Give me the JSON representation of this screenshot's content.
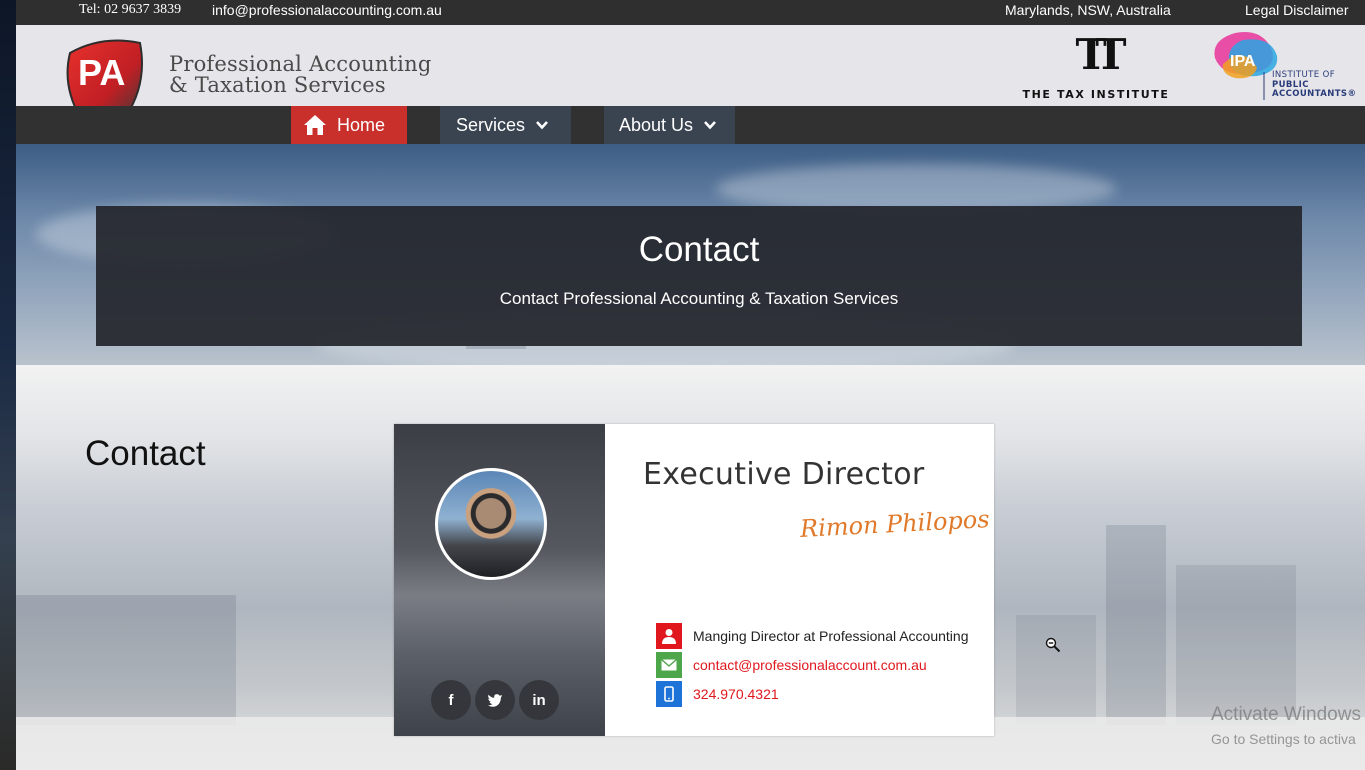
{
  "topbar": {
    "phone": "Tel: 02 9637 3839",
    "email": "info@professionalaccounting.com.au",
    "location": "Marylands, NSW, Australia",
    "legal": "Legal Disclaimer"
  },
  "header": {
    "logo_letters": "PA",
    "brand_line1": "Professional Accounting",
    "brand_line2": "& Taxation Services",
    "tax_institute": "THE TAX INSTITUTE",
    "ipa_mark": "IPA",
    "ipa_line1": "INSTITUTE OF",
    "ipa_line2": "PUBLIC",
    "ipa_line3": "ACCOUNTANTS"
  },
  "nav": {
    "home": "Home",
    "services": "Services",
    "about": "About Us"
  },
  "hero": {
    "title": "Contact",
    "subtitle": "Contact Professional Accounting & Taxation Services"
  },
  "content": {
    "title": "Contact"
  },
  "card": {
    "title": "Executive Director",
    "signature": "Rimon Philopos",
    "role": "Manging Director at Professional Accounting",
    "email": "contact@professionalaccount.com.au",
    "phone": "324.970.4321",
    "social": {
      "facebook": "f",
      "linkedin": "in"
    }
  },
  "watermark": {
    "line1": "Activate Windows",
    "line2": "Go to Settings to activa"
  },
  "colors": {
    "accent_red": "#c9302c",
    "nav_bg": "#313131",
    "signature": "#e07a2a",
    "mail_icon": "#4ea64a",
    "phone_icon": "#1e73d8"
  },
  "icons": [
    "home-icon",
    "chevron-down-icon",
    "facebook-icon",
    "twitter-icon",
    "linkedin-icon",
    "user-icon",
    "mail-icon",
    "mobile-icon",
    "zoom-out-cursor-icon"
  ]
}
